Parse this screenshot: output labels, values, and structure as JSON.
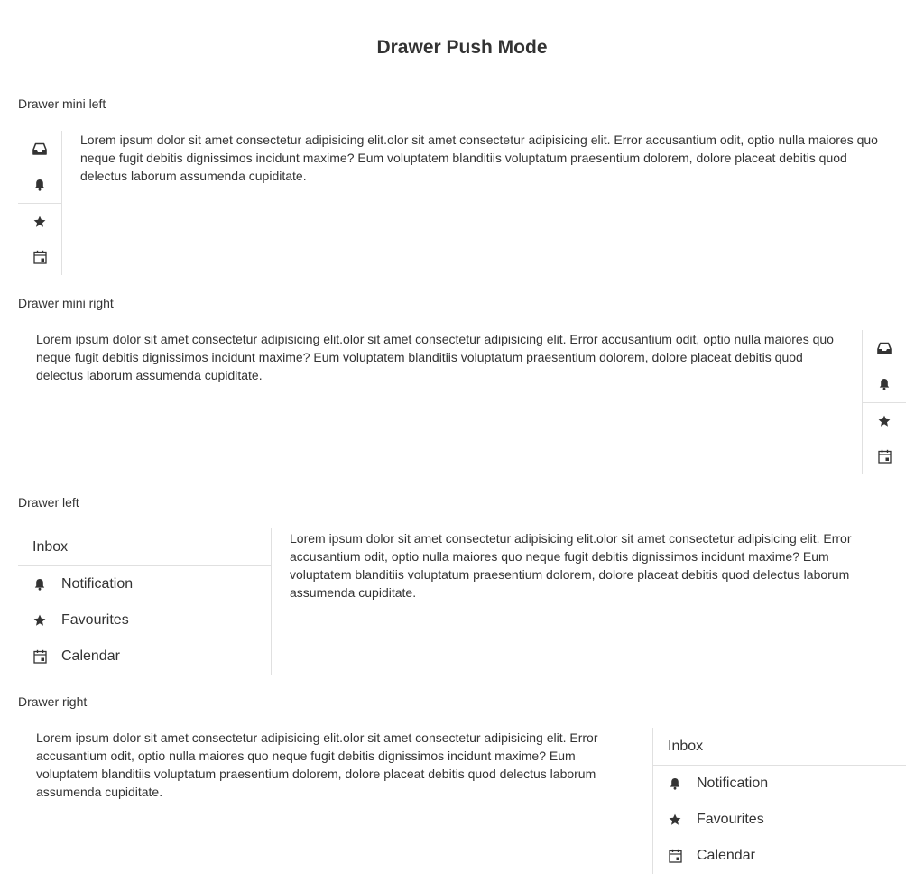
{
  "page": {
    "title": "Drawer Push Mode"
  },
  "lorem": "Lorem ipsum dolor sit amet consectetur adipisicing elit.olor sit amet consectetur adipisicing elit. Error accusantium odit, optio nulla maiores quo neque fugit debitis dignissimos incidunt maxime? Eum voluptatem blanditiis voluptatum praesentium dolorem, dolore placeat debitis quod delectus laborum assumenda cupiditate.",
  "sections": {
    "mini_left": {
      "title": "Drawer mini left"
    },
    "mini_right": {
      "title": "Drawer mini right"
    },
    "left": {
      "title": "Drawer left"
    },
    "right": {
      "title": "Drawer right"
    }
  },
  "drawer": {
    "header": "Inbox",
    "items": [
      {
        "label": "Notification",
        "icon": "bell-icon"
      },
      {
        "label": "Favourites",
        "icon": "star-icon"
      },
      {
        "label": "Calendar",
        "icon": "calendar-icon"
      }
    ],
    "mini_icons": [
      "inbox-icon",
      "bell-icon",
      "star-icon",
      "calendar-icon"
    ]
  },
  "colors": {
    "text": "#333333",
    "icon": "#333333",
    "divider": "#e0e0e0",
    "background": "#ffffff"
  }
}
